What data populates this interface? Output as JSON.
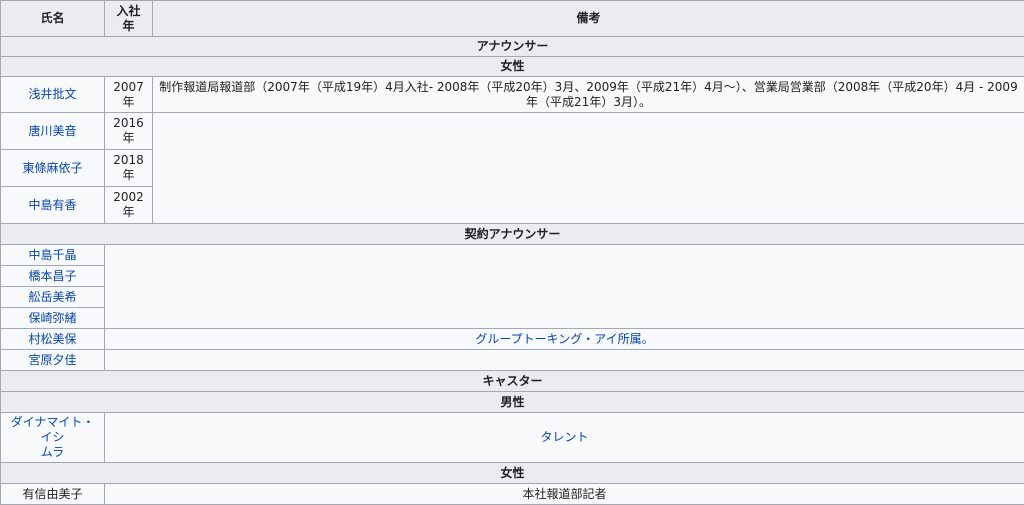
{
  "header": {
    "name": "氏名",
    "year_l1": "入社",
    "year_l2": "年",
    "note": "備考"
  },
  "sections": {
    "announcer": "アナウンサー",
    "female1": "女性",
    "contract": "契約アナウンサー",
    "caster": "キャスター",
    "male": "男性",
    "female2": "女性"
  },
  "female_announcers": [
    {
      "name": "浅井批文",
      "year": "2007",
      "unit": "年",
      "note": "制作報道局報道部（2007年（平成19年）4月入社- 2008年（平成20年）3月、2009年（平成21年）4月～）、営業局営業部（2008年（平成20年）4月 - 2009年（平成21年）3月）。"
    },
    {
      "name": "唐川美音",
      "year": "2016",
      "unit": "年"
    },
    {
      "name": "東條麻依子",
      "year": "2018",
      "unit": "年"
    },
    {
      "name": "中島有香",
      "year": "2002",
      "unit": "年"
    }
  ],
  "contract_announcers": [
    {
      "name": "中島千晶"
    },
    {
      "name": "橋本昌子"
    },
    {
      "name": "舩岳美希"
    },
    {
      "name": "保崎弥緒"
    },
    {
      "name": "村松美保",
      "note": "グループトーキング・アイ所属。"
    },
    {
      "name": "宮原夕佳"
    }
  ],
  "casters_male": [
    {
      "name_l1": "ダイナマイト・イシ",
      "name_l2": "ムラ",
      "note": "タレント"
    }
  ],
  "casters_female": [
    {
      "name": "有信由美子",
      "note": "本社報道部記者"
    }
  ],
  "colors": {
    "link": "#0645ad",
    "border": "#a2a9b1",
    "header_bg": "#eaecf0",
    "cell_bg": "#f8f9fa"
  }
}
